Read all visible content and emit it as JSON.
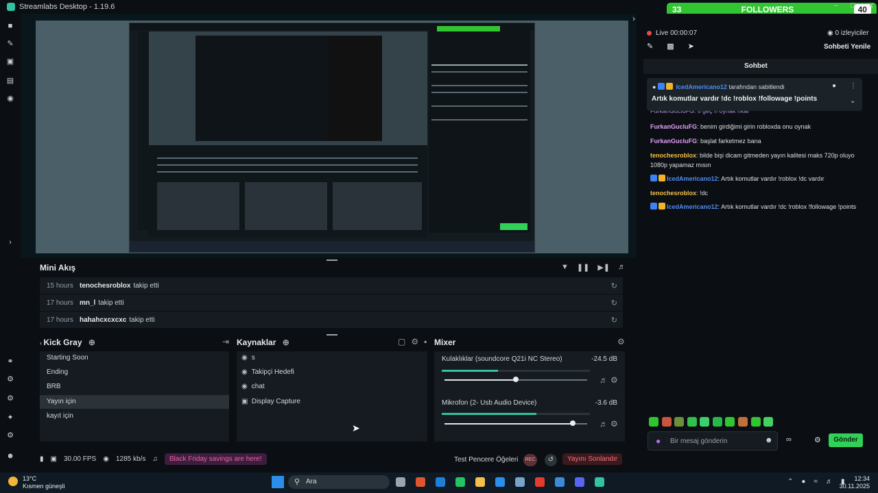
{
  "window": {
    "title": "Streamlabs Desktop - 1.19.6"
  },
  "followers_bar": {
    "left_count": "33",
    "label": "FOLLOWERS",
    "right_count": "40"
  },
  "left_nav": [
    "editor-icon",
    "themes-icon",
    "store-icon",
    "layout-icon",
    "record-icon",
    "studio-mode-icon",
    "tools-icon",
    "settings-icon",
    "profile-icon"
  ],
  "mini_feed": {
    "title": "Mini Akış",
    "rows": [
      {
        "time": "15 hours",
        "user": "tenochesroblox",
        "action": "takip etti"
      },
      {
        "time": "17 hours",
        "user": "mn_l",
        "action": "takip etti"
      },
      {
        "time": "17 hours",
        "user": "hahahcxcxcxc",
        "action": "takip etti"
      }
    ]
  },
  "scenes": {
    "title": "Kick Gray",
    "items": [
      "Starting Soon",
      "Ending",
      "BRB",
      "Yayın için",
      "kayıt için"
    ],
    "selected": "Yayın için"
  },
  "sources": {
    "title": "Kaynaklar",
    "items": [
      {
        "icon": "globe-icon",
        "label": "s"
      },
      {
        "icon": "globe-icon",
        "label": "Takipçi Hedefi"
      },
      {
        "icon": "globe-icon",
        "label": "chat"
      },
      {
        "icon": "monitor-icon",
        "label": "Display Capture"
      }
    ]
  },
  "mixer": {
    "title": "Mixer",
    "channels": [
      {
        "name": "Kulaklıklar (soundcore Q21i NC Stereo)",
        "db": "-24.5 dB",
        "level": 0.38,
        "volume": 0.5
      },
      {
        "name": "Mikrofon (2- Usb Audio Device)",
        "db": "-3.6 dB",
        "level": 0.64,
        "volume": 0.9
      }
    ]
  },
  "footer": {
    "fps": "30.00 FPS",
    "bitrate": "1285 kb/s",
    "promo": "Black Friday savings are here!",
    "test_widgets": "Test Pencere Öğeleri",
    "rec": "REC",
    "end_stream": "Yayını Sonlandır"
  },
  "chat": {
    "live_status": "Live 00:00:07",
    "viewers": "0 izleyiciler",
    "refresh_label": "Sohbeti Yenile",
    "header": "Sohbet",
    "pinned_by": "IcedAmericano12",
    "pinned_suffix": "tarafından sabitlendi",
    "pinned_text": "Artık komutlar vardır !dc !roblox !followage !points",
    "clipped_line": "FurkanGucluFG: ti geç ri oynak rikar",
    "messages": [
      {
        "user": "FurkanGucluFG",
        "style": "u1",
        "text": "benim girdiğimi girin robloxda onu oynak"
      },
      {
        "user": "FurkanGucluFG",
        "style": "u1",
        "text": "başlat farketmez bana"
      },
      {
        "user": "tenochesroblox",
        "style": "u2",
        "text": "bilde bişi dicam gitmeden yayın kalitesi maks 720p oluyo 1080p yapamaz mısın"
      },
      {
        "user": "IcedAmericano12",
        "style": "u3",
        "text": "Artık komutlar vardır !roblox !dc vardır"
      },
      {
        "user": "tenochesroblox",
        "style": "u2",
        "text": "!dc"
      },
      {
        "user": "IcedAmericano12",
        "style": "u3",
        "text": "Artık komutlar vardır !dc !roblox !followage !points"
      }
    ],
    "input_placeholder": "Bir mesaj gönderin",
    "send_label": "Gönder"
  },
  "taskbar": {
    "weather_temp": "13°C",
    "weather_desc": "Kısmen güneşli",
    "search": "Ara",
    "time": "12:34",
    "date": "30.11.2025"
  },
  "colors": {
    "accent": "#31c3a2",
    "followers": "#31c531",
    "send": "#31d158",
    "live": "#e84a4a"
  }
}
